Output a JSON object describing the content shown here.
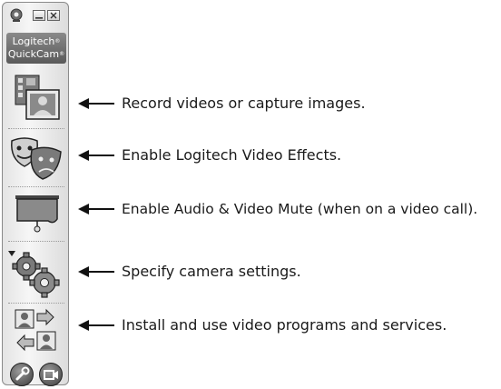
{
  "window": {
    "brand_line1": "Logitech",
    "brand_line2": "QuickCam",
    "brand_mark": "®"
  },
  "tools": [
    {
      "name": "record-capture",
      "icon": "film-photo-icon",
      "description": "Record videos or capture images."
    },
    {
      "name": "video-effects",
      "icon": "theater-masks-icon",
      "description": "Enable Logitech Video Effects."
    },
    {
      "name": "audio-video-mute",
      "icon": "privacy-shade-icon",
      "description": "Enable Audio & Video Mute (when on a video call)."
    },
    {
      "name": "camera-settings",
      "icon": "gears-icon",
      "description": "Specify camera settings."
    },
    {
      "name": "video-programs",
      "icon": "contacts-arrows-icon",
      "description": "Install and use video programs and services."
    }
  ],
  "footer_buttons": [
    {
      "name": "help",
      "icon": "wrench-icon"
    },
    {
      "name": "camera",
      "icon": "video-camera-icon"
    }
  ],
  "colors": {
    "panel": "#e4e4e4",
    "text": "#1a1a1a",
    "icon": "#6a6a6a"
  }
}
